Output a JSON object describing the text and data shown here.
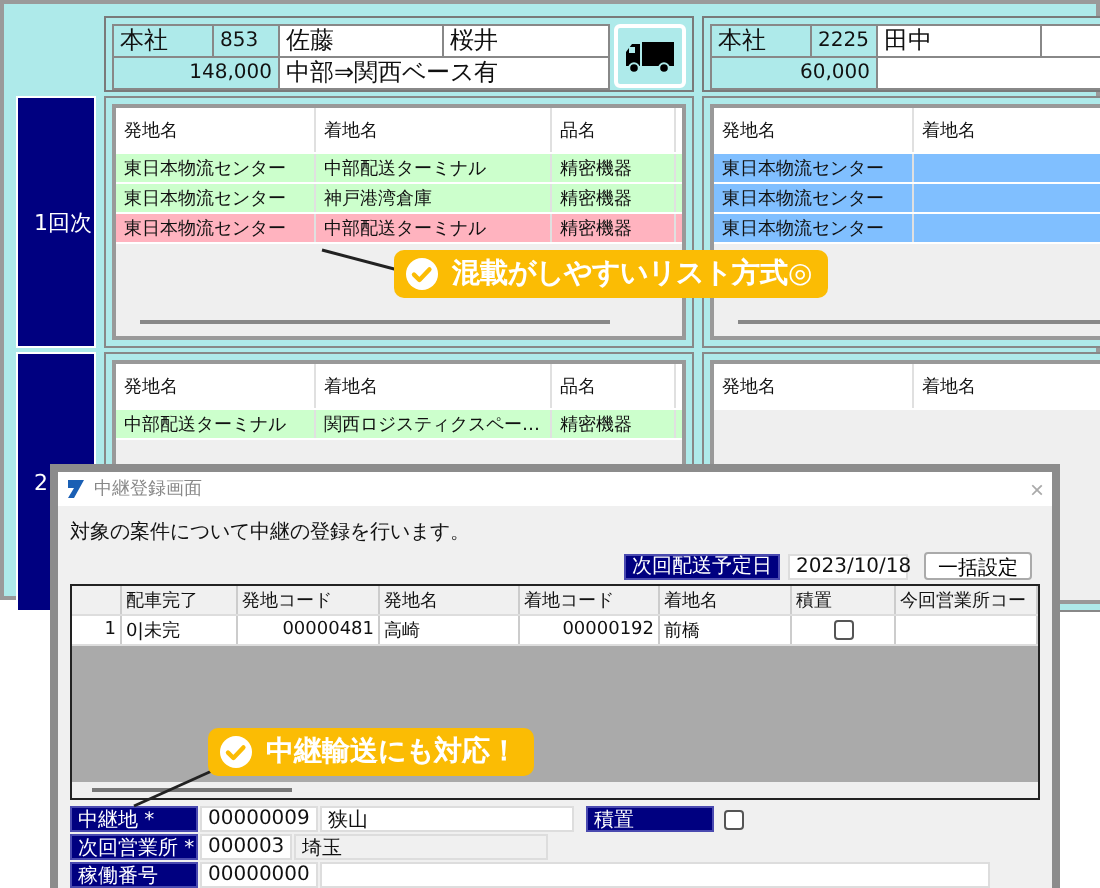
{
  "rounds": [
    {
      "label": "1回次"
    },
    {
      "label": "2"
    }
  ],
  "panels": [
    {
      "header": {
        "office": "本社",
        "code": "853",
        "driver": "佐藤",
        "assistant": "桜井",
        "amount": "148,000",
        "route": "中部⇒関西ベース有",
        "truck_button": true
      },
      "lists": [
        {
          "columns": [
            "発地名",
            "着地名",
            "品名"
          ],
          "rows": [
            {
              "cells": [
                "東日本物流センター",
                "中部配送ターミナル",
                "精密機器"
              ],
              "color": "#ccffcc"
            },
            {
              "cells": [
                "東日本物流センター",
                "神戸港湾倉庫",
                "精密機器"
              ],
              "color": "#ccffcc"
            },
            {
              "cells": [
                "東日本物流センター",
                "中部配送ターミナル",
                "精密機器"
              ],
              "color": "#ffb3bf"
            }
          ]
        },
        {
          "columns": [
            "発地名",
            "着地名",
            "品名"
          ],
          "rows": [
            {
              "cells": [
                "中部配送ターミナル",
                "関西ロジスティクスペー…",
                "精密機器"
              ],
              "color": "#ccffcc"
            }
          ]
        }
      ]
    },
    {
      "header": {
        "office": "本社",
        "code": "2225",
        "driver": "田中",
        "amount": "60,000"
      },
      "lists": [
        {
          "columns": [
            "発地名",
            "着地名"
          ],
          "rows": [
            {
              "cells": [
                "東日本物流センター"
              ],
              "color": "#80bfff"
            },
            {
              "cells": [
                "東日本物流センター"
              ],
              "color": "#80bfff"
            },
            {
              "cells": [
                "東日本物流センター"
              ],
              "color": "#80bfff"
            }
          ]
        },
        {
          "columns": [
            "発地名",
            "着地名"
          ]
        }
      ]
    }
  ],
  "callouts": [
    {
      "text": "混載がしやすいリスト方式◎"
    },
    {
      "text": "中継輸送にも対応！"
    }
  ],
  "dialog": {
    "title": "中継登録画面",
    "close": "×",
    "message": "対象の案件について中継の登録を行います。",
    "date_label": "次回配送予定日",
    "date": "2023/10/18",
    "bulk_button": "一括設定",
    "grid": {
      "columns": [
        "配車完了",
        "発地コード",
        "発地名",
        "着地コード",
        "着地名",
        "積置",
        "今回営業所コー"
      ],
      "rows": [
        {
          "number": "1",
          "cells": [
            "0|未完",
            "00000481",
            "高崎",
            "00000192",
            "前橋"
          ],
          "stowed": false
        }
      ]
    },
    "fields": [
      {
        "label": "中継地 *",
        "code": "00000009",
        "name": "狭山",
        "readonly": false,
        "extra_label": "積置",
        "extra_checked": false
      },
      {
        "label": "次回営業所 *",
        "code": "000003",
        "name": "埼玉",
        "readonly": true
      },
      {
        "label": "稼働番号",
        "code": "00000000",
        "readonly": false
      }
    ]
  }
}
